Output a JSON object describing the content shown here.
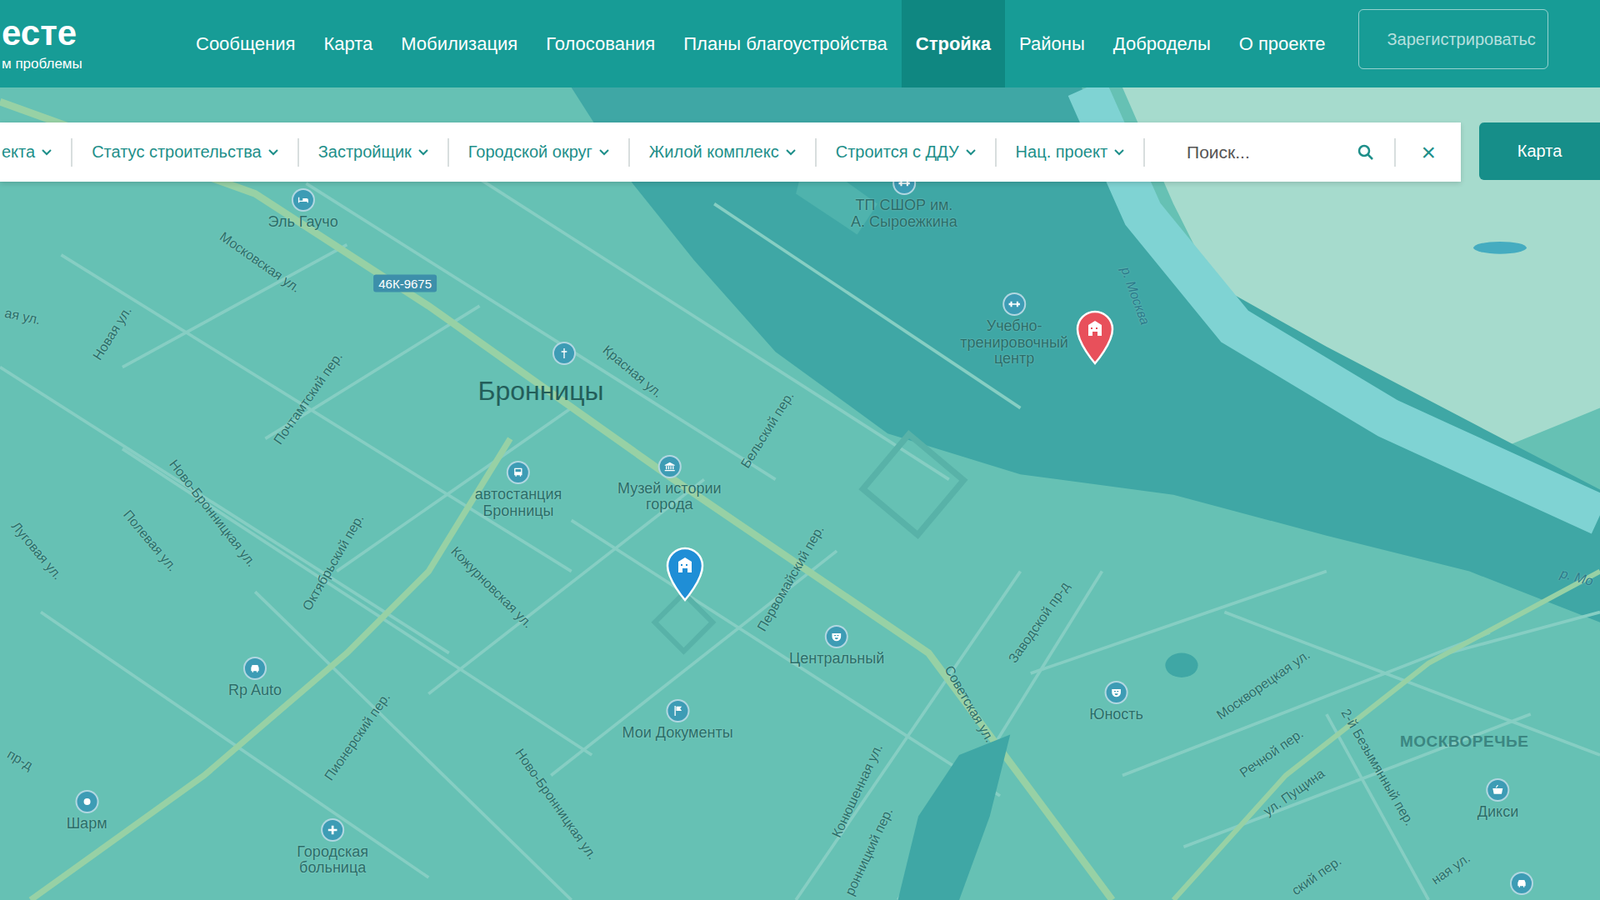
{
  "logo": {
    "title": "есте",
    "subtitle": "м проблемы"
  },
  "nav": [
    {
      "label": "Сообщения",
      "selected": false
    },
    {
      "label": "Карта",
      "selected": false
    },
    {
      "label": "Мобилизация",
      "selected": false
    },
    {
      "label": "Голосования",
      "selected": false
    },
    {
      "label": "Планы благоустройства",
      "selected": false
    },
    {
      "label": "Стройка",
      "selected": true
    },
    {
      "label": "Районы",
      "selected": false
    },
    {
      "label": "Доброделы",
      "selected": false
    },
    {
      "label": "О проекте",
      "selected": false
    }
  ],
  "register_button": "Зарегистрироватьс",
  "filters": [
    {
      "label": "екта"
    },
    {
      "label": "Статус строительства"
    },
    {
      "label": "Застройщик"
    },
    {
      "label": "Городской округ"
    },
    {
      "label": "Жилой комплекс"
    },
    {
      "label": "Строится с ДДУ"
    },
    {
      "label": "Нац. проект"
    }
  ],
  "search": {
    "placeholder": "Поиск...",
    "clear": "×"
  },
  "map_button": "Карта",
  "map": {
    "city": "Бронницы",
    "district": "МОСКВОРЕЧЬЕ",
    "road_badge": "46К-9675",
    "pins": [
      {
        "kind": "school",
        "color": "#1f8ed6"
      },
      {
        "kind": "school",
        "color": "#e8505b"
      }
    ],
    "places": [
      {
        "label": "Эль Гаучо",
        "kind": "hotel"
      },
      {
        "label": "ТП СШОР им.\nА. Сыроежкина",
        "kind": "sport"
      },
      {
        "label": "Учебно-\nтренировочный\nцентр",
        "kind": "sport"
      },
      {
        "label": "автостанция\nБронницы",
        "kind": "bus"
      },
      {
        "label": "Музей истории\nгорода",
        "kind": "museum"
      },
      {
        "label": "Центральный",
        "kind": "theatre"
      },
      {
        "label": "Юность",
        "kind": "theatre"
      },
      {
        "label": "Rp Auto",
        "kind": "car"
      },
      {
        "label": "Мои Документы",
        "kind": "docs"
      },
      {
        "label": "Шарм",
        "kind": "beauty"
      },
      {
        "label": "Городская\nбольница",
        "kind": "hospital"
      },
      {
        "label": "Дикси",
        "kind": "shop"
      }
    ],
    "markers": [
      {
        "kind": "church"
      },
      {
        "kind": "car"
      }
    ],
    "streets": [
      {
        "label": "Московская ул."
      },
      {
        "label": "ая ул."
      },
      {
        "label": "Новая ул."
      },
      {
        "label": "Почтамтский пер."
      },
      {
        "label": "Красная ул."
      },
      {
        "label": "Бельский пер."
      },
      {
        "label": "Ново-Бронницкая ул."
      },
      {
        "label": "Полевая ул."
      },
      {
        "label": "Луговая ул."
      },
      {
        "label": "Октябрьский пер."
      },
      {
        "label": "Кожурновская ул."
      },
      {
        "label": "Первомайский пер."
      },
      {
        "label": "Советская ул."
      },
      {
        "label": "Заводской пр-д"
      },
      {
        "label": "Пионерский пер."
      },
      {
        "label": "Ново-Бронницкая ул."
      },
      {
        "label": "Конюшенная ул."
      },
      {
        "label": "ронницкий пер."
      },
      {
        "label": "Москворецкая ул."
      },
      {
        "label": "Речной пер."
      },
      {
        "label": "ул. Пущина"
      },
      {
        "label": "2-й Безымянный пер."
      },
      {
        "label": "пр-д"
      },
      {
        "label": "ский пер."
      },
      {
        "label": "ная ул."
      }
    ],
    "water_labels": [
      {
        "label": "р. Москва"
      },
      {
        "label": "р. Мо"
      }
    ]
  }
}
